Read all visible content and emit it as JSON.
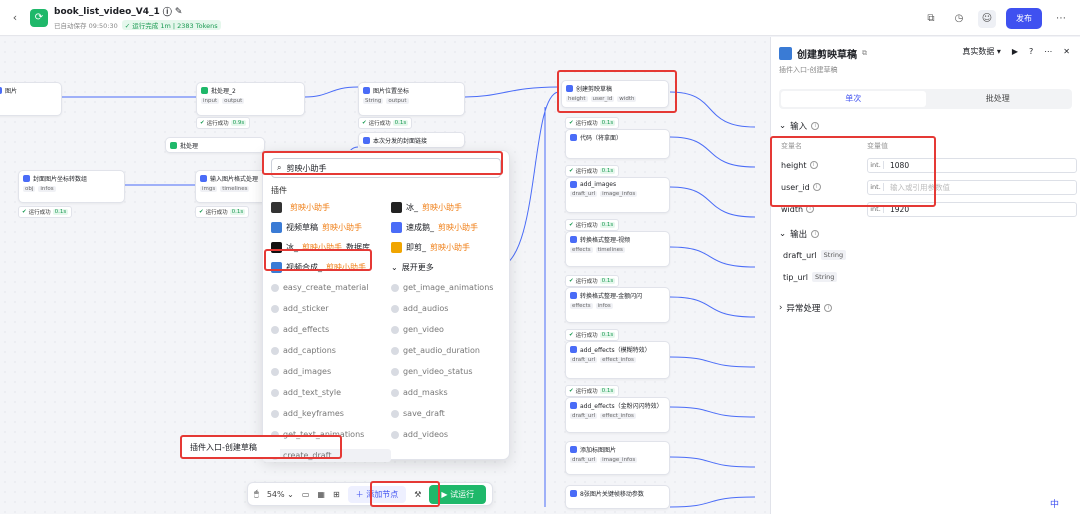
{
  "header": {
    "back_icon": "chevron-left-icon",
    "app_title": "book_list_video_V4_1",
    "autosave": "已自动保存 09:50:30",
    "run_status": "运行完成 1m | 2383 Tokens",
    "publish_label": "发布"
  },
  "canvas": {
    "nodes": [
      {
        "title": "图片",
        "inputs": [
          "",
          ""
        ]
      },
      {
        "title": "批处理_2",
        "inputs": [
          "input",
          "output"
        ]
      },
      {
        "title": "图片位置坐标",
        "inputs": [
          "String",
          "output"
        ]
      },
      {
        "title": "批处理",
        "inputs": []
      },
      {
        "title": "本次分发的封面链接",
        "inputs": []
      },
      {
        "title": "封面图片坐标转数组",
        "inputs": [
          "obj",
          "infos"
        ]
      },
      {
        "title": "输入图片格式处理",
        "inputs": [
          "imgs",
          "timelines"
        ]
      },
      {
        "title": "创建剪映草稿",
        "inputs": [
          "height",
          "user_id",
          "width",
          "draft_url",
          "tip_url"
        ]
      },
      {
        "title": "代码（将拿面）",
        "inputs": []
      },
      {
        "title": "add_images",
        "inputs": [
          "draft_url",
          "image_infos"
        ]
      },
      {
        "title": "转换格式整理-视频",
        "inputs": [
          "effects",
          "timelines"
        ]
      },
      {
        "title": "转换格式整理-金额闪闪",
        "inputs": [
          "effects",
          "infos"
        ]
      },
      {
        "title": "add_effects（模糊特效）",
        "inputs": [
          "draft_url",
          "effect_infos"
        ]
      },
      {
        "title": "add_effects（金粉闪闪特效）",
        "inputs": [
          "draft_url",
          "effect_infos"
        ]
      },
      {
        "title": "添加标图图片",
        "inputs": [
          "draft_url",
          "image_infos"
        ]
      },
      {
        "title": "8张图片关键帧移动参数",
        "inputs": []
      }
    ],
    "run_success": "运行成功",
    "run_times": [
      "0.9s",
      "0.1s",
      "0.1s",
      "0.1s",
      "0.1s",
      "0.1s",
      "0.1s",
      "0.1s",
      "0.1s",
      "0.1s"
    ]
  },
  "search": {
    "query": "剪映小助手",
    "section_title": "插件",
    "plugins": [
      {
        "prefix": "",
        "hl": "剪映小助手",
        "suffix": ""
      },
      {
        "prefix": "冰_",
        "hl": "剪映小助手",
        "suffix": ""
      },
      {
        "prefix": "视频草稿",
        "hl": "剪映小助手",
        "suffix": ""
      },
      {
        "prefix": "速成鹅_",
        "hl": "剪映小助手",
        "suffix": ""
      },
      {
        "prefix": "冰_",
        "hl": "剪映小助手",
        "suffix": "数据库"
      },
      {
        "prefix": "即剪_",
        "hl": "剪映小助手",
        "suffix": ""
      },
      {
        "prefix": "视频合成_",
        "hl": "剪映小助手",
        "suffix": ""
      }
    ],
    "expand_label": "展开更多",
    "functions": [
      "easy_create_material",
      "get_image_animations",
      "add_sticker",
      "add_audios",
      "add_effects",
      "gen_video",
      "add_captions",
      "get_audio_duration",
      "add_images",
      "gen_video_status",
      "add_text_style",
      "add_masks",
      "add_keyframes",
      "save_draft",
      "get_text_animations",
      "add_videos",
      "create_draft"
    ],
    "callout": "插件入口-创建草稿"
  },
  "bottom_bar": {
    "zoom": "54%",
    "add_node_label": "添加节点",
    "trial_run_label": "试运行"
  },
  "panel": {
    "title": "创建剪映草稿",
    "subtitle": "插件入口-创建草稿",
    "data_mode": "真实数据",
    "tab_single": "单次",
    "tab_batch": "批处理",
    "input_title": "输入",
    "col_name": "变量名",
    "col_value": "变量值",
    "inputs": [
      {
        "name": "height",
        "type": "int.",
        "value": "1080",
        "placeholder": ""
      },
      {
        "name": "user_id",
        "type": "int.",
        "value": "",
        "placeholder": "输入或引用参数值"
      },
      {
        "name": "width",
        "type": "int.",
        "value": "1920",
        "placeholder": ""
      }
    ],
    "output_title": "输出",
    "outputs": [
      {
        "name": "draft_url",
        "type": "String"
      },
      {
        "name": "tip_url",
        "type": "String"
      }
    ],
    "exception_title": "异常处理"
  },
  "lang_label": "中"
}
